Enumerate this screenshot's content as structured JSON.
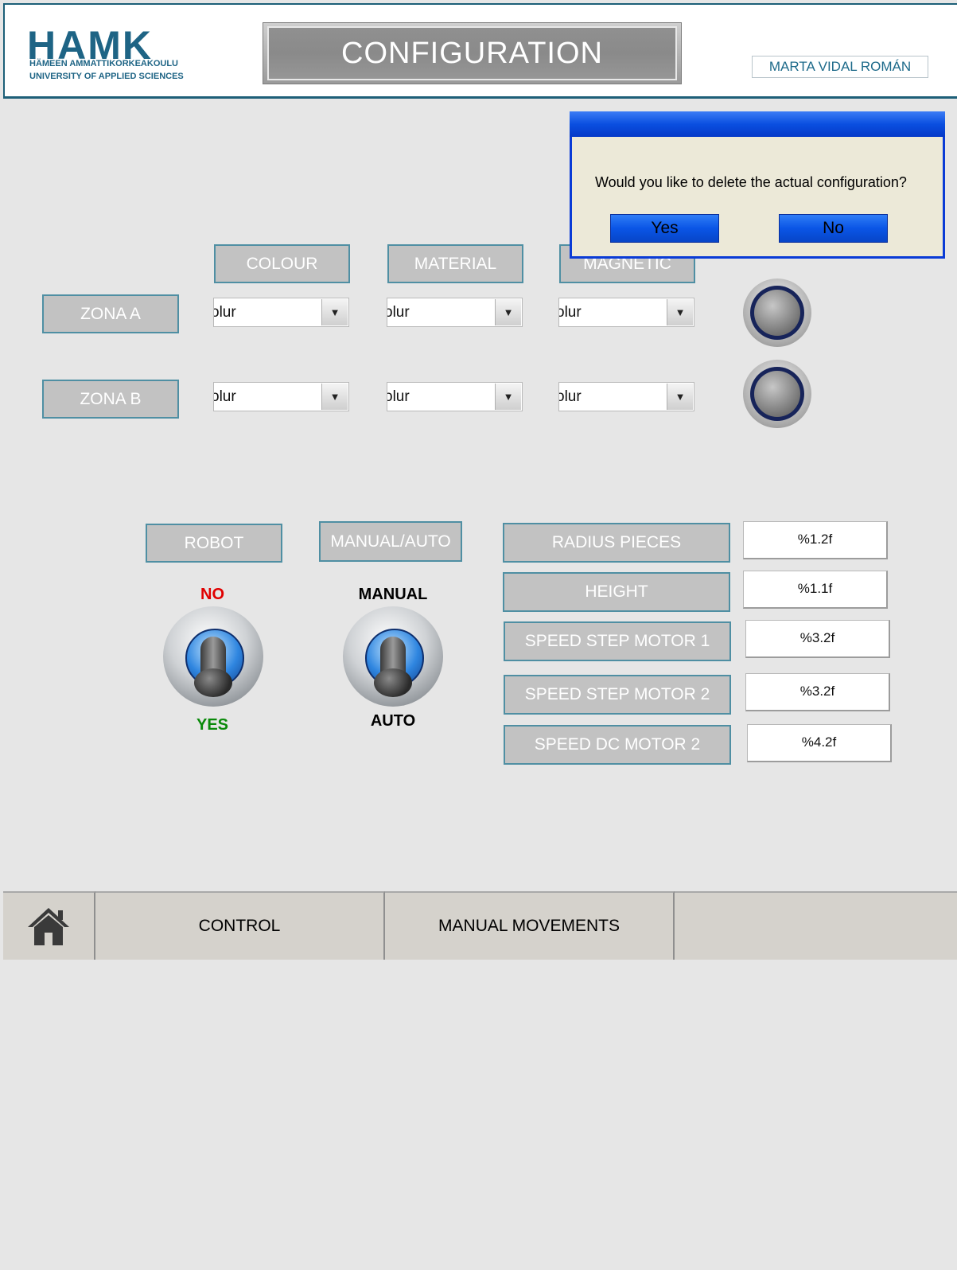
{
  "header": {
    "logo": "HAMK",
    "logo_line1": "HÄMEEN AMMATTIKORKEAKOULU",
    "logo_line2": "UNIVERSITY OF APPLIED SCIENCES",
    "title": "CONFIGURATION",
    "author": "MARTA VIDAL ROMÁN"
  },
  "columns": {
    "colour": "COLOUR",
    "material": "MATERIAL",
    "magnetic": "MAGNETIC"
  },
  "zones": [
    {
      "label": "ZONA A",
      "colour": "olur",
      "material": "olur",
      "magnetic": "olur"
    },
    {
      "label": "ZONA B",
      "colour": "olur",
      "material": "olur",
      "magnetic": "olur"
    }
  ],
  "robot": {
    "label": "ROBOT",
    "top": "NO",
    "bottom": "YES"
  },
  "mode": {
    "label": "MANUAL/AUTO",
    "top": "MANUAL",
    "bottom": "AUTO"
  },
  "parameters": [
    {
      "label": "RADIUS PIECES",
      "value": "%1.2f"
    },
    {
      "label": "HEIGHT",
      "value": "%1.1f"
    },
    {
      "label": "SPEED STEP MOTOR 1",
      "value": "%3.2f"
    },
    {
      "label": "SPEED STEP MOTOR 2",
      "value": "%3.2f"
    },
    {
      "label": "SPEED DC MOTOR 2",
      "value": "%4.2f"
    }
  ],
  "nav": {
    "home_icon": "home-icon",
    "control": "CONTROL",
    "manual_movements": "MANUAL MOVEMENTS"
  },
  "dialog": {
    "message": "Would you like to delete the actual configuration?",
    "yes": "Yes",
    "no": "No"
  },
  "colors": {
    "accent": "#1d5f78",
    "no_label": "#e00000",
    "yes_label": "#0a8a0a",
    "dialog_button": "#0a55e6"
  }
}
